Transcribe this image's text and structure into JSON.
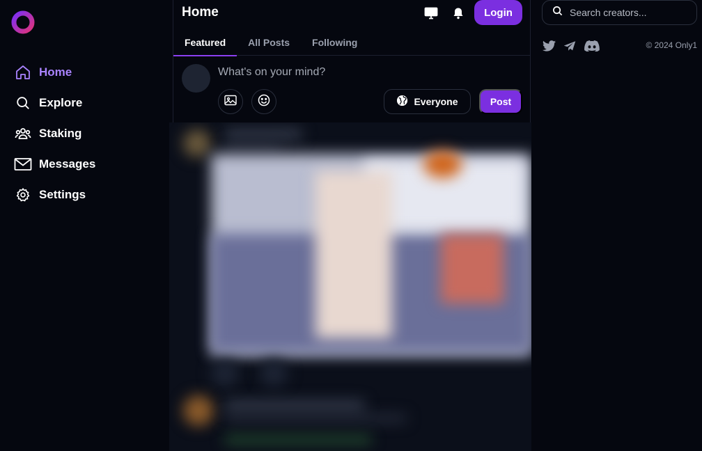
{
  "sidebar": {
    "logo": "only1-logo",
    "items": [
      {
        "label": "Home",
        "icon": "home-icon",
        "active": true
      },
      {
        "label": "Explore",
        "icon": "search-icon",
        "active": false
      },
      {
        "label": "Staking",
        "icon": "users-icon",
        "active": false
      },
      {
        "label": "Messages",
        "icon": "mail-icon",
        "active": false
      },
      {
        "label": "Settings",
        "icon": "gear-icon",
        "active": false
      }
    ]
  },
  "header": {
    "title": "Home",
    "login_label": "Login",
    "icons": [
      "monitor-icon",
      "bell-icon"
    ]
  },
  "tabs": [
    {
      "label": "Featured",
      "active": true
    },
    {
      "label": "All Posts",
      "active": false
    },
    {
      "label": "Following",
      "active": false
    }
  ],
  "composer": {
    "placeholder": "What's on your mind?",
    "audience_label": "Everyone",
    "post_label": "Post"
  },
  "right": {
    "search_placeholder": "Search creators...",
    "socials": [
      "twitter-icon",
      "telegram-icon",
      "discord-icon"
    ],
    "copyright": "© 2024 Only1"
  },
  "colors": {
    "background": "#05070f",
    "accent": "#7b2fe0",
    "active_nav": "#a983ff",
    "border": "#1c2030"
  }
}
